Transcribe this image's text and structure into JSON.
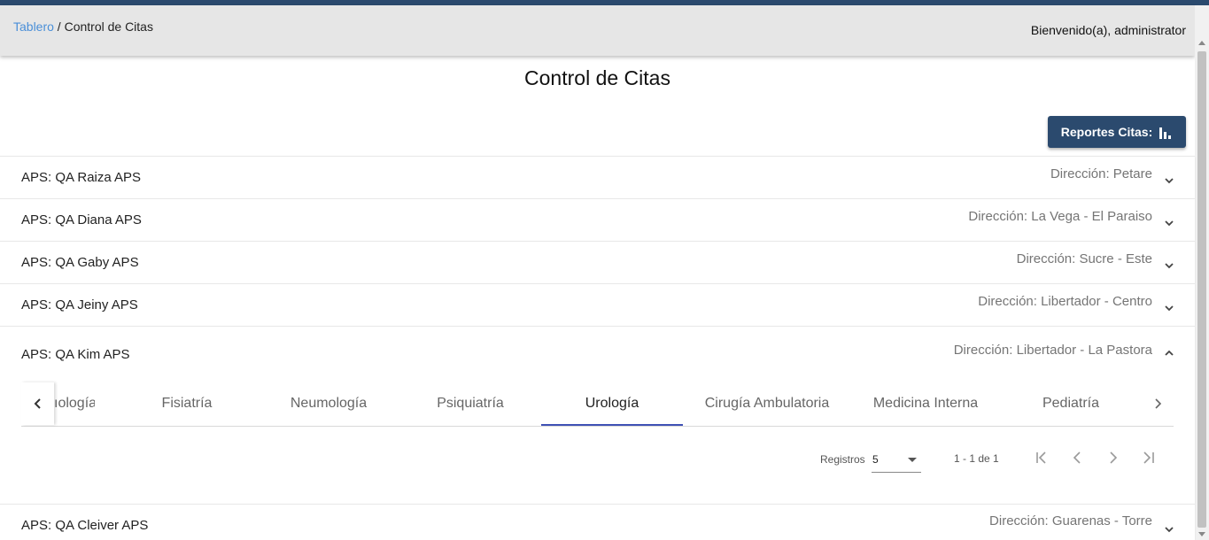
{
  "header": {
    "breadcrumb": {
      "link": "Tablero",
      "separator": " / ",
      "current": "Control de Citas"
    },
    "welcome": "Bienvenido(a), administrator"
  },
  "page": {
    "title": "Control de Citas",
    "report_button": "Reportes Citas:",
    "report_icon": "bar-chart-icon"
  },
  "panels": [
    {
      "title": "APS: QA Raiza APS",
      "direction": "Dirección: Petare",
      "expanded": false
    },
    {
      "title": "APS: QA Diana APS",
      "direction": "Dirección: La Vega - El Paraiso",
      "expanded": false
    },
    {
      "title": "APS: QA Gaby APS",
      "direction": "Dirección: Sucre - Este",
      "expanded": false
    },
    {
      "title": "APS: QA Jeiny APS",
      "direction": "Dirección: Libertador - Centro",
      "expanded": false
    },
    {
      "title": "APS: QA Kim APS",
      "direction": "Dirección: Libertador - La Pastora",
      "expanded": true
    },
    {
      "title": "APS: QA Cleiver APS",
      "direction": "Dirección: Guarenas - Torre",
      "expanded": false
    }
  ],
  "tabs": {
    "items": [
      "ıología",
      "Fisiatría",
      "Neumología",
      "Psiquiatría",
      "Urología",
      "Cirugía Ambulatoria",
      "Medicina Interna",
      "Pediatría"
    ],
    "active": "Urología"
  },
  "paginator": {
    "label": "Registros",
    "page_size": "5",
    "range": "1 - 1 de 1"
  },
  "colors": {
    "primary": "#2b4a6e",
    "link": "#4a8fd8",
    "tab_indicator": "#3f51b5"
  }
}
